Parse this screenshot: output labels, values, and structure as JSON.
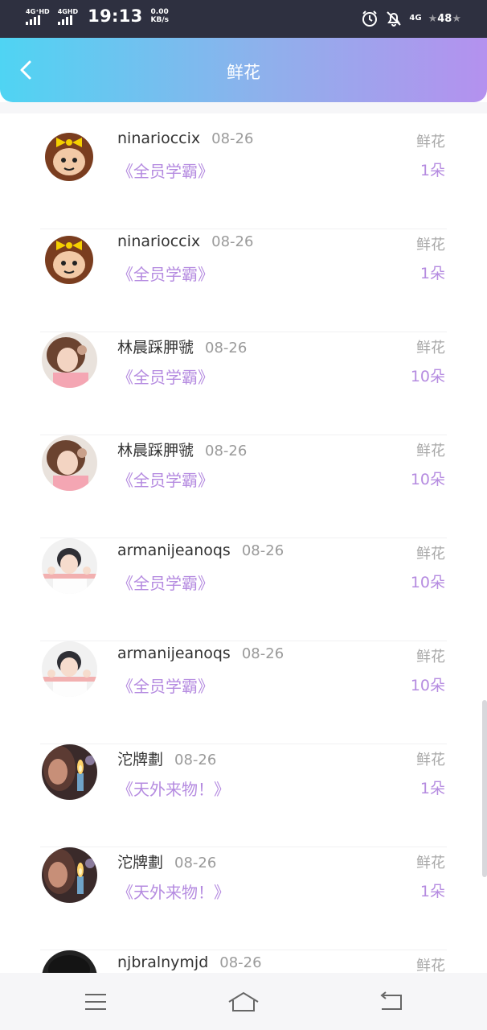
{
  "status_bar": {
    "network1": "4G⁺HD",
    "network2": "4GHD",
    "time": "19:13",
    "speed_value": "0.00",
    "speed_unit": "KB/s",
    "net_type": "4G",
    "battery": "48"
  },
  "header": {
    "title": "鲜花",
    "back_icon": "back-arrow-icon"
  },
  "records": [
    {
      "username": "ninarioccix",
      "date": "08-26",
      "gift": "《全员学霸》",
      "type": "鲜花",
      "count": "1朵",
      "avatar": "cartoon-girl"
    },
    {
      "username": "ninarioccix",
      "date": "08-26",
      "gift": "《全员学霸》",
      "type": "鲜花",
      "count": "1朵",
      "avatar": "cartoon-girl"
    },
    {
      "username": "林晨踩胛虢",
      "date": "08-26",
      "gift": "《全员学霸》",
      "type": "鲜花",
      "count": "10朵",
      "avatar": "photo-girl-pink"
    },
    {
      "username": "林晨踩胛虢",
      "date": "08-26",
      "gift": "《全员学霸》",
      "type": "鲜花",
      "count": "10朵",
      "avatar": "photo-girl-pink"
    },
    {
      "username": "armanijeanoqs",
      "date": "08-26",
      "gift": "《全员学霸》",
      "type": "鲜花",
      "count": "10朵",
      "avatar": "photo-girl-white"
    },
    {
      "username": "armanijeanoqs",
      "date": "08-26",
      "gift": "《全员学霸》",
      "type": "鲜花",
      "count": "10朵",
      "avatar": "photo-girl-white"
    },
    {
      "username": "沱牌劃",
      "date": "08-26",
      "gift": "《天外来物！》",
      "type": "鲜花",
      "count": "1朵",
      "avatar": "photo-lighter"
    },
    {
      "username": "沱牌劃",
      "date": "08-26",
      "gift": "《天外来物！》",
      "type": "鲜花",
      "count": "1朵",
      "avatar": "photo-lighter"
    },
    {
      "username": "njbralnymjd",
      "date": "08-26",
      "gift": "",
      "type": "鲜花",
      "count": "",
      "avatar": "photo-dark-hair"
    }
  ],
  "nav_bar": {
    "menu_icon": "menu-icon",
    "home_icon": "home-icon",
    "back_icon": "return-icon"
  },
  "colors": {
    "header_gradient_start": "#4fd4f3",
    "header_gradient_end": "#b491ee",
    "accent_purple": "#b58be0",
    "status_bar": "#2e3040"
  }
}
